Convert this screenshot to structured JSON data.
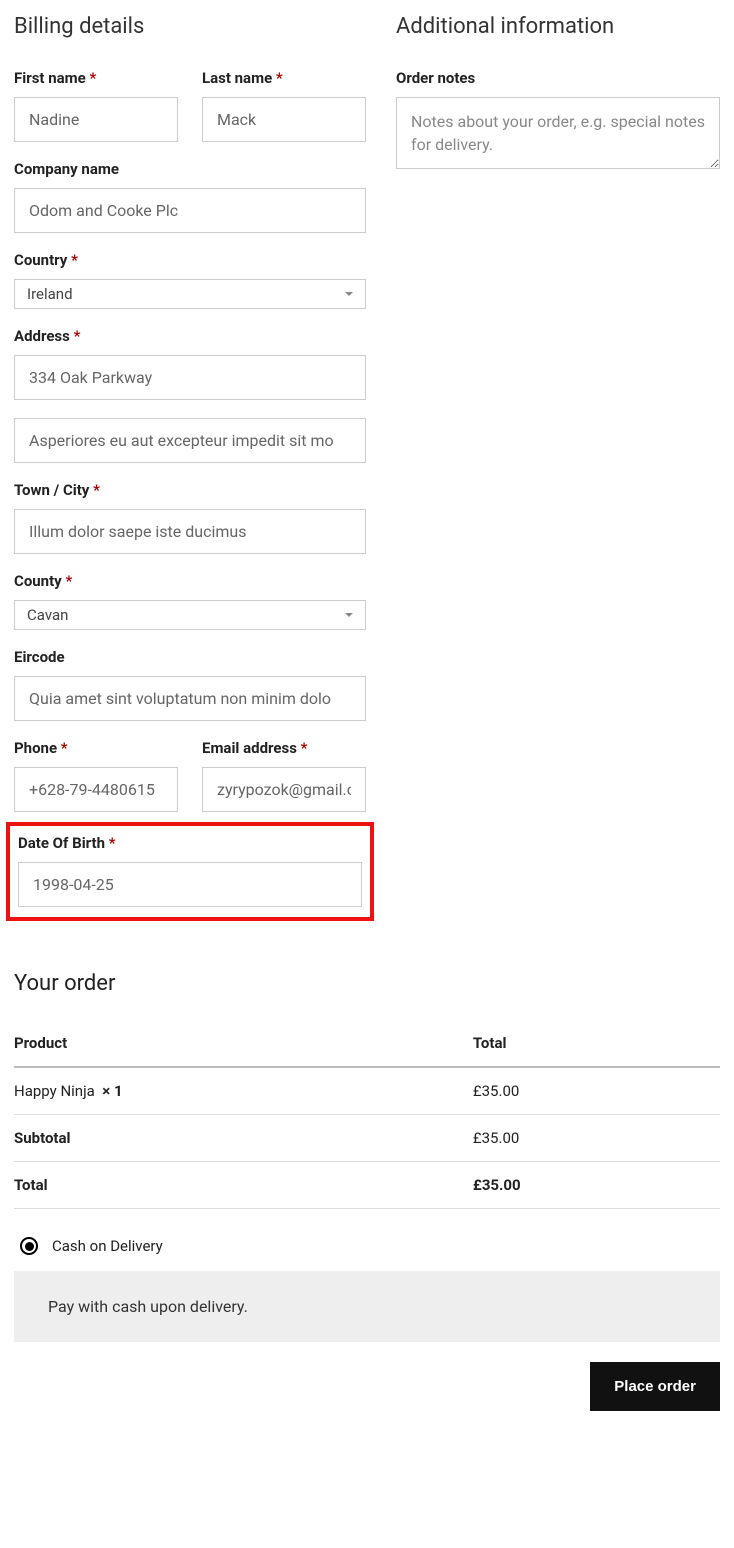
{
  "billing": {
    "heading": "Billing details",
    "first_name_label": "First name",
    "first_name_value": "Nadine",
    "last_name_label": "Last name",
    "last_name_value": "Mack",
    "company_label": "Company name",
    "company_value": "Odom and Cooke Plc",
    "country_label": "Country",
    "country_value": "Ireland",
    "address_label": "Address",
    "address1_value": "334 Oak Parkway",
    "address2_value": "Asperiores eu aut excepteur impedit sit mo",
    "city_label": "Town / City",
    "city_value": "Illum dolor saepe iste ducimus",
    "county_label": "County",
    "county_value": "Cavan",
    "eircode_label": "Eircode",
    "eircode_value": "Quia amet sint voluptatum non minim dolo",
    "phone_label": "Phone",
    "phone_value": "+628-79-4480615",
    "email_label": "Email address",
    "email_value": "zyrypozok@gmail.c",
    "dob_label": "Date Of Birth",
    "dob_value": "1998-04-25"
  },
  "additional": {
    "heading": "Additional information",
    "notes_label": "Order notes",
    "notes_placeholder": "Notes about your order, e.g. special notes for delivery."
  },
  "order": {
    "heading": "Your order",
    "product_col": "Product",
    "total_col": "Total",
    "item_name": "Happy Ninja",
    "item_qty": "× 1",
    "item_total": "£35.00",
    "subtotal_label": "Subtotal",
    "subtotal_value": "£35.00",
    "total_label": "Total",
    "total_value": "£35.00"
  },
  "payment": {
    "method": "Cash on Delivery",
    "desc": "Pay with cash upon delivery.",
    "button": "Place order"
  },
  "asterisk": "*"
}
